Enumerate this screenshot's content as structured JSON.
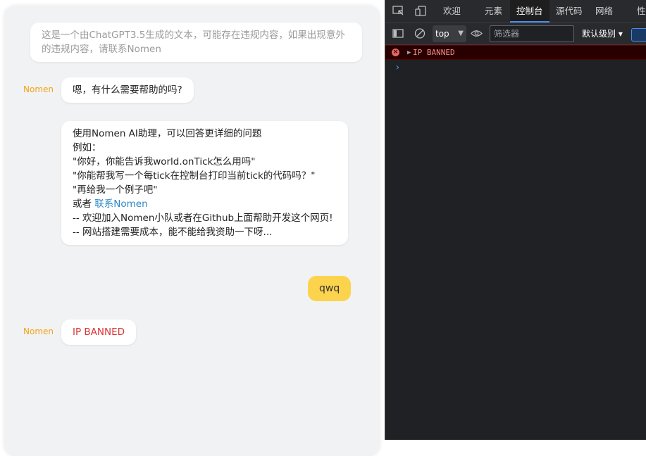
{
  "chat": {
    "notice": "这是一个由ChatGPT3.5生成的文本，可能存在违规内容，如果出现意外的违规内容，请联系Nomen",
    "messages": [
      {
        "sender": "Nomen",
        "text": "嗯，有什么需要帮助的吗?"
      },
      {
        "lines": [
          "使用Nomen AI助理，可以回答更详细的问题",
          "例如：",
          "\"你好，你能告诉我world.onTick怎么用吗\"",
          "\"你能帮我写一个每tick在控制台打印当前tick的代码吗？\"",
          "\"再给我一个例子吧\""
        ],
        "link_prefix": "或者 ",
        "link_text": "联系Nomen",
        "lines_after": [
          "-- 欢迎加入Nomen小队或者在Github上面帮助开发这个网页!",
          "-- 网站搭建需要成本，能不能给我资助一下呀..."
        ]
      },
      {
        "sender_user": true,
        "text": "qwq"
      },
      {
        "sender": "Nomen",
        "text": "IP BANNED"
      }
    ]
  },
  "devtools": {
    "tabs": [
      "欢迎",
      "元素",
      "控制台",
      "源代码",
      "网络",
      "性能"
    ],
    "active_tab": "控制台",
    "context": "top",
    "filter_placeholder": "筛选器",
    "level": "默认级别 ▾",
    "console_error": "IP BANNED",
    "prompt": "›"
  },
  "colors": {
    "sender_name": "#f2a313",
    "user_bubble": "#fcd34d",
    "error_text": "#d93535",
    "link": "#2f88c7"
  }
}
